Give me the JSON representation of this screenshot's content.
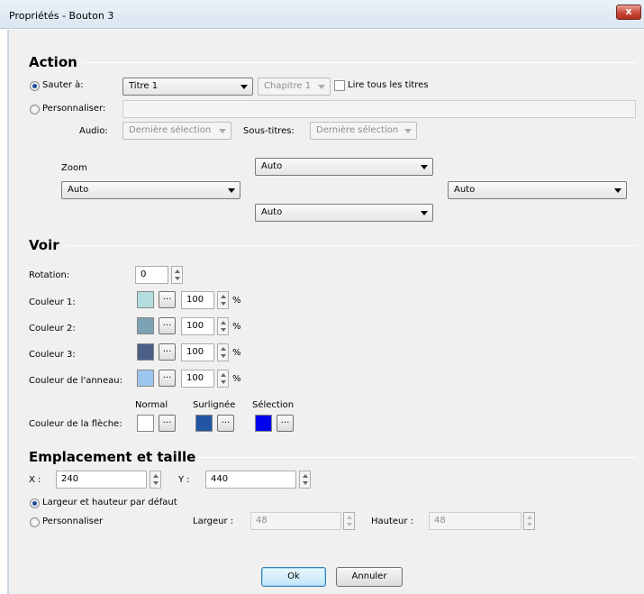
{
  "window": {
    "title": "Propriétés - Bouton 3",
    "close_glyph": "x"
  },
  "action": {
    "heading": "Action",
    "sauter_label": "Sauter à:",
    "titre_value": "Titre 1",
    "chapitre_value": "Chapitre 1",
    "lire_tous_label": "Lire tous les titres",
    "personnaliser_label": "Personnaliser:",
    "audio_label": "Audio:",
    "audio_value": "Dernière sélection",
    "soustitres_label": "Sous-titres:",
    "soustitres_value": "Dernière sélection",
    "zoom_label": "Zoom",
    "zoom_top": "Auto",
    "zoom_left": "Auto",
    "zoom_right": "Auto",
    "zoom_bottom": "Auto"
  },
  "voir": {
    "heading": "Voir",
    "rotation_label": "Rotation:",
    "rotation_value": "0",
    "couleurs": [
      {
        "label": "Couleur 1:",
        "value": "100",
        "color": "#b4dde0"
      },
      {
        "label": "Couleur 2:",
        "value": "100",
        "color": "#7aa2b2"
      },
      {
        "label": "Couleur 3:",
        "value": "100",
        "color": "#4a6086"
      },
      {
        "label": "Couleur de l'anneau:",
        "value": "100",
        "color": "#9dc6ef"
      }
    ],
    "percent": "%",
    "dots": "...",
    "fleche_label": "Couleur de la flèche:",
    "normal_label": "Normal",
    "surlignee_label": "Surlignée",
    "selection_label": "Sélection",
    "normal_color": "#ffffff",
    "surlignee_color": "#2255a4",
    "selection_color": "#0000ee"
  },
  "emplacement": {
    "heading": "Emplacement et taille",
    "x_label": "X :",
    "x_value": "240",
    "y_label": "Y :",
    "y_value": "440",
    "default_label": "Largeur et hauteur par défaut",
    "custom_label": "Personnaliser",
    "largeur_label": "Largeur :",
    "largeur_value": "48",
    "hauteur_label": "Hauteur :",
    "hauteur_value": "48"
  },
  "buttons": {
    "ok": "Ok",
    "cancel": "Annuler"
  }
}
